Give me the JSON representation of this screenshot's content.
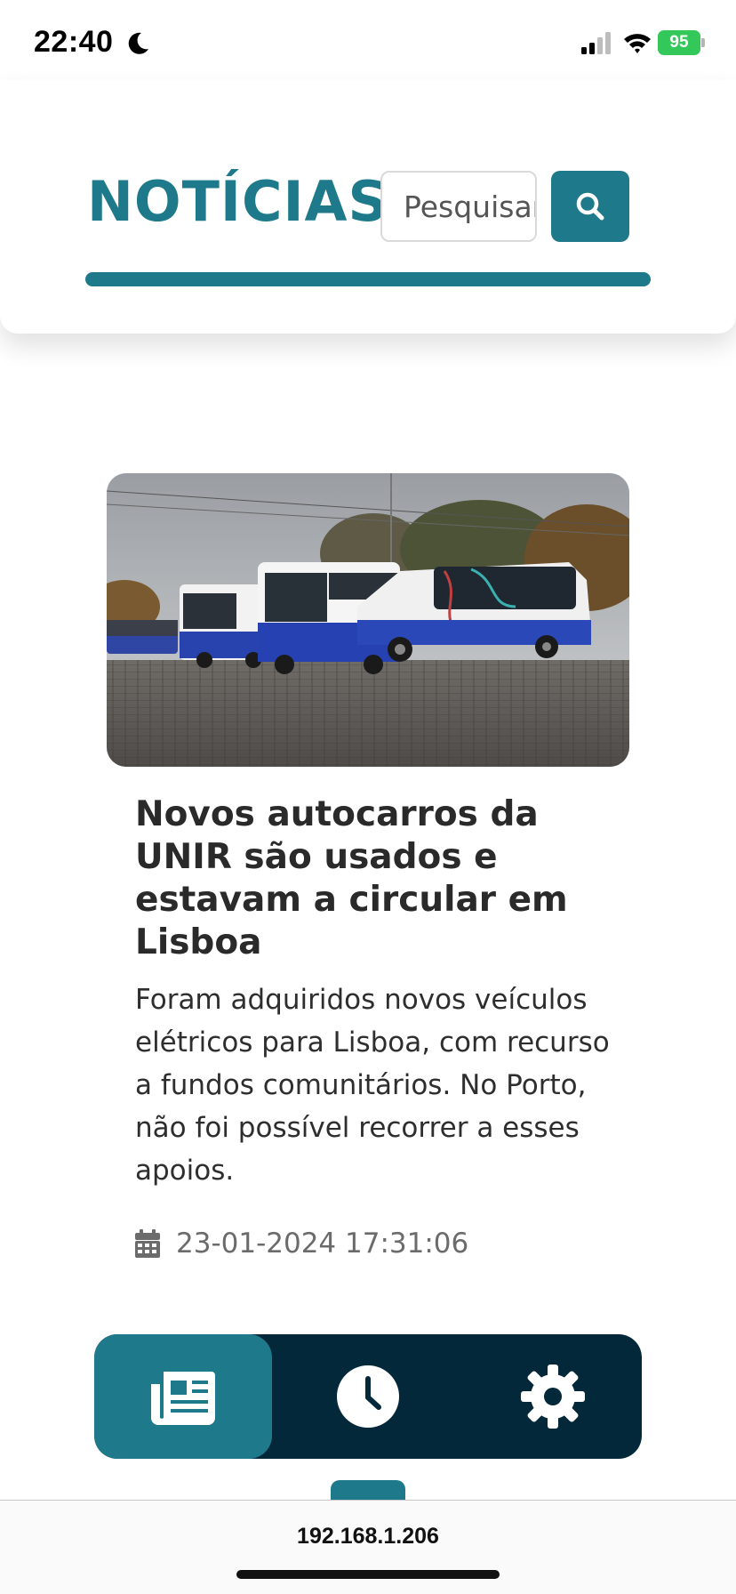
{
  "status_bar": {
    "time": "22:40",
    "battery": "95"
  },
  "header": {
    "title": "NOTÍCIAS",
    "search_placeholder": "Pesquisar"
  },
  "news": {
    "title": "Novos autocarros da UNIR são usados e estavam a circular em Lisboa",
    "summary": "Foram adquiridos novos veículos elétricos para Lisboa, com recurso a fundos comunitários. No Porto, não foi possível recorrer a esses apoios.",
    "date": "23-01-2024 17:31:06"
  },
  "nav": {
    "items": [
      {
        "icon": "newspaper-icon",
        "active": true
      },
      {
        "icon": "clock-icon",
        "active": false
      },
      {
        "icon": "gear-icon",
        "active": false
      }
    ]
  },
  "browser": {
    "url": "192.168.1.206"
  },
  "colors": {
    "accent": "#1e7a8a",
    "nav_bg": "#03283a",
    "battery": "#34c759"
  }
}
